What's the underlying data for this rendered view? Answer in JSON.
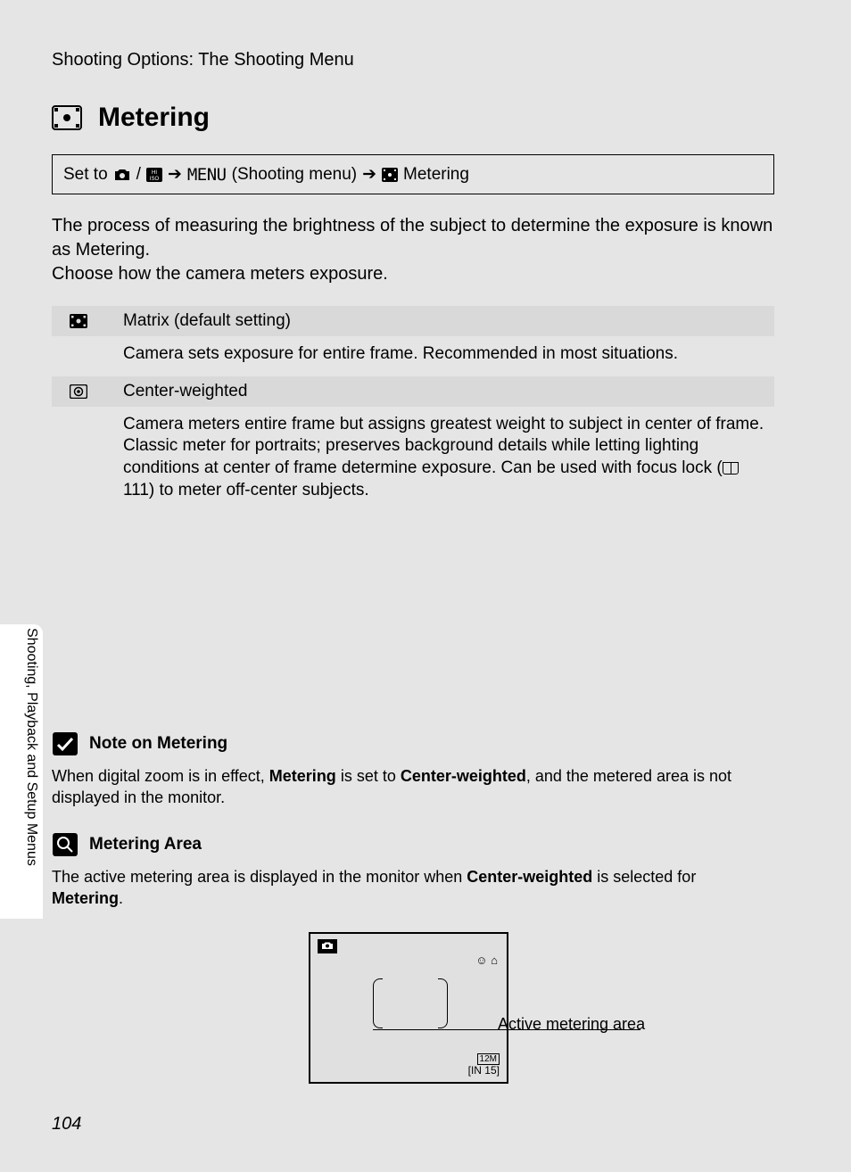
{
  "breadcrumb": "Shooting Options: The Shooting Menu",
  "heading": "Metering",
  "setto": {
    "prefix": "Set to",
    "slash": "/",
    "arrow": "➔",
    "menu_word": "MENU",
    "menu_paren": "(Shooting menu)",
    "tail": "Metering"
  },
  "intro": {
    "p1": "The process of measuring the brightness of the subject to determine the exposure is known as Metering.",
    "p2": "Choose how the camera meters exposure."
  },
  "options": [
    {
      "title": "Matrix (default setting)",
      "body": "Camera sets exposure for entire frame. Recommended in most situations."
    },
    {
      "title": "Center-weighted",
      "body_pre": "Camera meters entire frame but assigns greatest weight to subject in center of frame. Classic meter for portraits; preserves background details while letting lighting conditions at center of frame determine exposure. Can be used with focus lock (",
      "body_ref": "111",
      "body_post": ") to meter off-center subjects."
    }
  ],
  "notes": {
    "n1": {
      "title": "Note on Metering",
      "pre": "When digital zoom is in effect, ",
      "b1": "Metering",
      "mid1": " is set to ",
      "b2": "Center-weighted",
      "post": ", and the metered area is not displayed in the monitor."
    },
    "n2": {
      "title": "Metering Area",
      "pre": "The active metering area is displayed in the monitor when ",
      "b1": "Center-weighted",
      "mid": " is selected for ",
      "b2": "Metering",
      "post": "."
    }
  },
  "callout": "Active metering area",
  "monitor": {
    "badge_icon_name": "camera-icon",
    "size_label": "12M",
    "memory_label": "IN",
    "count": "15"
  },
  "side_label": "Shooting, Playback and Setup Menus",
  "page_number": "104"
}
